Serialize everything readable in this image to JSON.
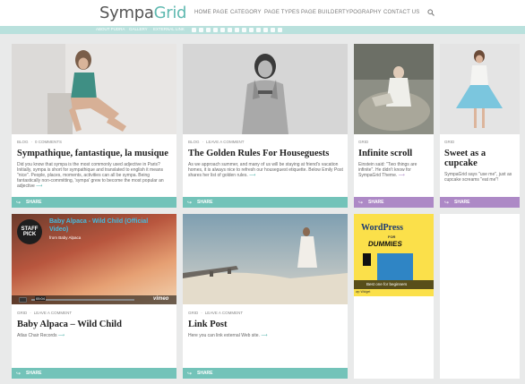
{
  "header": {
    "logo_part1": "Sympa",
    "logo_part2": "Grid",
    "nav": [
      "HOME PAGE",
      "CATEGORY",
      "PAGE TYPES",
      "PAGE BUILDER",
      "TYPOGRAPHY",
      "CONTACT US"
    ]
  },
  "subbar": {
    "links": [
      "ABOUT PUDRA",
      "GALLERY",
      "EXTERNAL LINK"
    ],
    "social_icons": [
      "facebook-icon",
      "twitter-icon",
      "youtube-icon",
      "vimeo-icon",
      "linkedin-icon",
      "skype-icon",
      "instagram-icon",
      "google-plus-icon",
      "tumblr-icon",
      "flickr-icon",
      "dribbble-icon",
      "pinterest-icon",
      "rss-icon"
    ]
  },
  "colors": {
    "teal": "#73c3b9",
    "purple": "#ad89c6",
    "subbar": "#b9e1dd"
  },
  "posts": [
    {
      "meta": [
        "BLOG",
        "0 COMMENTS"
      ],
      "title": "Sympathique, fantastique, la musique",
      "excerpt": "Did you know that sympa is the most commonly used adjective in Paris? Initially, sympa is short for sympathique and translated to english it means \"nice\". People, places, moments, activities can all be sympa. Being fantastically non-committing, 'sympa' grew to become the most popular an adjective",
      "share": "SHARE"
    },
    {
      "meta": [
        "BLOG",
        "LEAVE A COMMENT"
      ],
      "title": "The Golden Rules For Houseguests",
      "excerpt": "As we approach summer, and many of us will be staying at friend's vacation homes, it is always nice to refresh our houseguest etiquette. Below Emily Post shares her list of golden rules.",
      "share": "SHARE"
    },
    {
      "meta": [
        "GRID"
      ],
      "title": "Infinite scroll",
      "excerpt": "Einstein said: \"Two things are infinite\". He didn't know for SympaGrid Theme.",
      "share": "SHARE"
    },
    {
      "meta": [
        "GRID"
      ],
      "title_line1": "Sweet as a",
      "title_line2": "cupcake",
      "excerpt": "SympaGrid says \"use me\", just as cupcake screams \"eat me\"!",
      "share": "SHARE"
    },
    {
      "meta": [
        "GRID",
        "LEAVE A COMMENT"
      ],
      "video_title_line1": "Baby Alpaca - Wild Child (Official",
      "video_title_line2": "Video)",
      "video_from": "from Baby Alpaca",
      "video_badge_line1": "STAFF",
      "video_badge_line2": "PICK",
      "video_time": "05:04",
      "vimeo_label": "vimeo",
      "title": "Baby Alpaca – Wild Child",
      "excerpt": "Atlas Chair Records",
      "share": "SHARE"
    },
    {
      "meta": [
        "GRID",
        "LEAVE A COMMENT"
      ],
      "title": "Link Post",
      "excerpt": "Here you can link external Web site.",
      "share": "SHARE"
    },
    {
      "book_title": "WordPress",
      "book_subtitle": "FOR",
      "book_brand": "DUMMIES",
      "caption": "Best one for beginners",
      "caption_small": "wp Widget"
    }
  ]
}
